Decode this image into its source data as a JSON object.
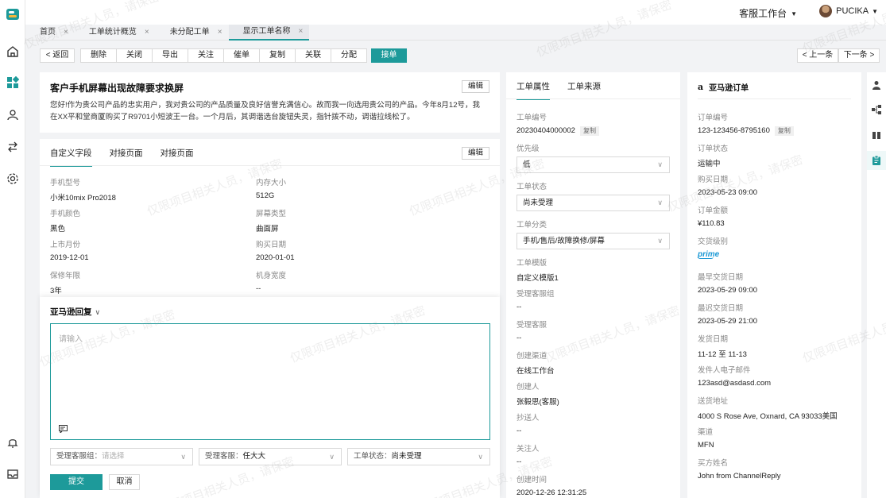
{
  "topbar": {
    "workspace": "客服工作台",
    "username": "PUCIKA"
  },
  "tabs": [
    {
      "label": "首页"
    },
    {
      "label": "工单统计概览"
    },
    {
      "label": "未分配工单"
    },
    {
      "label": "显示工单名称"
    }
  ],
  "toolbar": {
    "back": "< 返回",
    "actions": [
      "删除",
      "关闭",
      "导出",
      "关注",
      "催单",
      "复制",
      "关联",
      "分配"
    ],
    "accept": "接单",
    "prev": "< 上一条",
    "next": "下一条 >"
  },
  "ticket": {
    "title": "客户手机屏幕出现故障要求换屏",
    "edit": "编辑",
    "description": "您好!作为贵公司产品的忠实用户，我对贵公司的产品质量及良好信誉充满信心。故而我一向选用贵公司的产品。今年8月12号，我在XX平和堂商厦购买了R9701小短波王一台。一个月后，其调谐选台旋钮失灵，指针拨不动，调谐拉线松了。"
  },
  "fields": {
    "tabs": [
      "自定义字段",
      "对接页面",
      "对接页面"
    ],
    "edit": "编辑",
    "items": [
      {
        "label": "手机型号",
        "value": "小米10mix Pro2018"
      },
      {
        "label": "内存大小",
        "value": "512G"
      },
      {
        "label": "手机颜色",
        "value": "黑色"
      },
      {
        "label": "屏幕类型",
        "value": "曲面屏"
      },
      {
        "label": "上市月份",
        "value": "2019-12-01"
      },
      {
        "label": "购买日期",
        "value": "2020-01-01"
      },
      {
        "label": "保修年限",
        "value": "3年"
      },
      {
        "label": "机身宽度",
        "value": "--"
      }
    ]
  },
  "reply": {
    "title": "亚马逊回复",
    "placeholder": "请输入",
    "group_label": "受理客服组：",
    "group_placeholder": "请选择",
    "agent_label": "受理客服：",
    "agent_value": "任大大",
    "status_label": "工单状态：",
    "status_value": "尚未受理",
    "submit": "提交",
    "cancel": "取消"
  },
  "attributes": {
    "tabs": [
      "工单属性",
      "工单来源"
    ],
    "ticket_no_label": "工单编号",
    "ticket_no": "20230404000002",
    "copy": "复制",
    "priority_label": "优先级",
    "priority": "低",
    "status_label": "工单状态",
    "status": "尚未受理",
    "category_label": "工单分类",
    "category": "手机/售后/故障换修/屏幕",
    "template_label": "工单模版",
    "template": "自定义模版1",
    "group_label": "受理客服组",
    "group": "--",
    "agent_label": "受理客服",
    "agent": "--",
    "channel_label": "创建渠道",
    "channel": "在线工作台",
    "creator_label": "创建人",
    "creator": "张毅思(客服)",
    "cc_label": "抄送人",
    "cc": "--",
    "follower_label": "关注人",
    "follower": "--",
    "created_label": "创建时间",
    "created": "2020-12-26 12:31:25"
  },
  "amazon": {
    "title": "亚马逊订单",
    "order_no_label": "订单编号",
    "order_no": "123-123456-8795160",
    "copy": "复制",
    "status_label": "订单状态",
    "status": "运输中",
    "purchase_label": "购买日期",
    "purchase": "2023-05-23 09:00",
    "amount_label": "订单金额",
    "amount": "¥110.83",
    "level_label": "交货级别",
    "level": "prime",
    "earliest_label": "最早交货日期",
    "earliest": "2023-05-29 09:00",
    "latest_label": "最迟交货日期",
    "latest": "2023-05-29 21:00",
    "ship_label": "发货日期",
    "ship": "11-12 至 11-13",
    "email_label": "发件人电子邮件",
    "email": "123asd@asdasd.com",
    "address_label": "送货地址",
    "address": "4000 S Rose Ave, Oxnard, CA 93033美国",
    "channel_label": "渠道",
    "channel": "MFN",
    "buyer_label": "买方姓名",
    "buyer": "John from ChannelReply"
  },
  "watermark": "仅限项目相关人员，请保密"
}
